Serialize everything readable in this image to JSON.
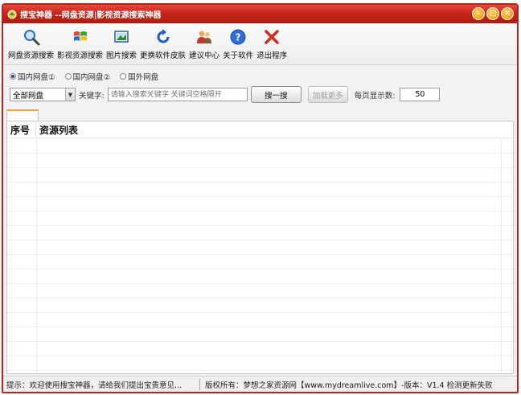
{
  "window": {
    "title": "搜宝神器 --网盘资源|影视资源搜索神器",
    "controls": {
      "minimize": "–",
      "maximize": "□",
      "close": "✕"
    }
  },
  "toolbar": {
    "items": [
      {
        "label": "网盘资源搜索",
        "icon": "magnifier-icon"
      },
      {
        "label": "影视资源搜索",
        "icon": "windows-flag-icon"
      },
      {
        "label": "图片搜索",
        "icon": "picture-icon"
      },
      {
        "label": "更换软件皮肤",
        "icon": "refresh-icon"
      },
      {
        "label": "建议中心",
        "icon": "people-icon"
      },
      {
        "label": "关于软件",
        "icon": "help-icon"
      },
      {
        "label": "退出程序",
        "icon": "exit-x-icon"
      }
    ]
  },
  "options": {
    "radios": [
      {
        "label": "国内网盘①",
        "checked": true
      },
      {
        "label": "国内网盘②",
        "checked": false
      },
      {
        "label": "国外网盘",
        "checked": false
      }
    ],
    "disk_select": "全部网盘",
    "keyword_label": "关键字:",
    "keyword_placeholder": "请输入搜索关键字 关键词空格隔开",
    "search_button": "搜一搜",
    "load_more_button": "加载更多",
    "per_page_label": "每页显示数:",
    "per_page_value": "50"
  },
  "list": {
    "col_no": "序号",
    "col_list": "资源列表"
  },
  "status": {
    "left": "提示：欢迎使用搜宝神器，请给我们提出宝贵意见...",
    "right": "版权所有：梦想之家资源网【www.mydreamlive.com】-版本：V1.4  检测更新失败"
  },
  "colors": {
    "titlebar": "#c7251a",
    "border": "#b8241c",
    "window_bg": "#f2f2f2"
  }
}
